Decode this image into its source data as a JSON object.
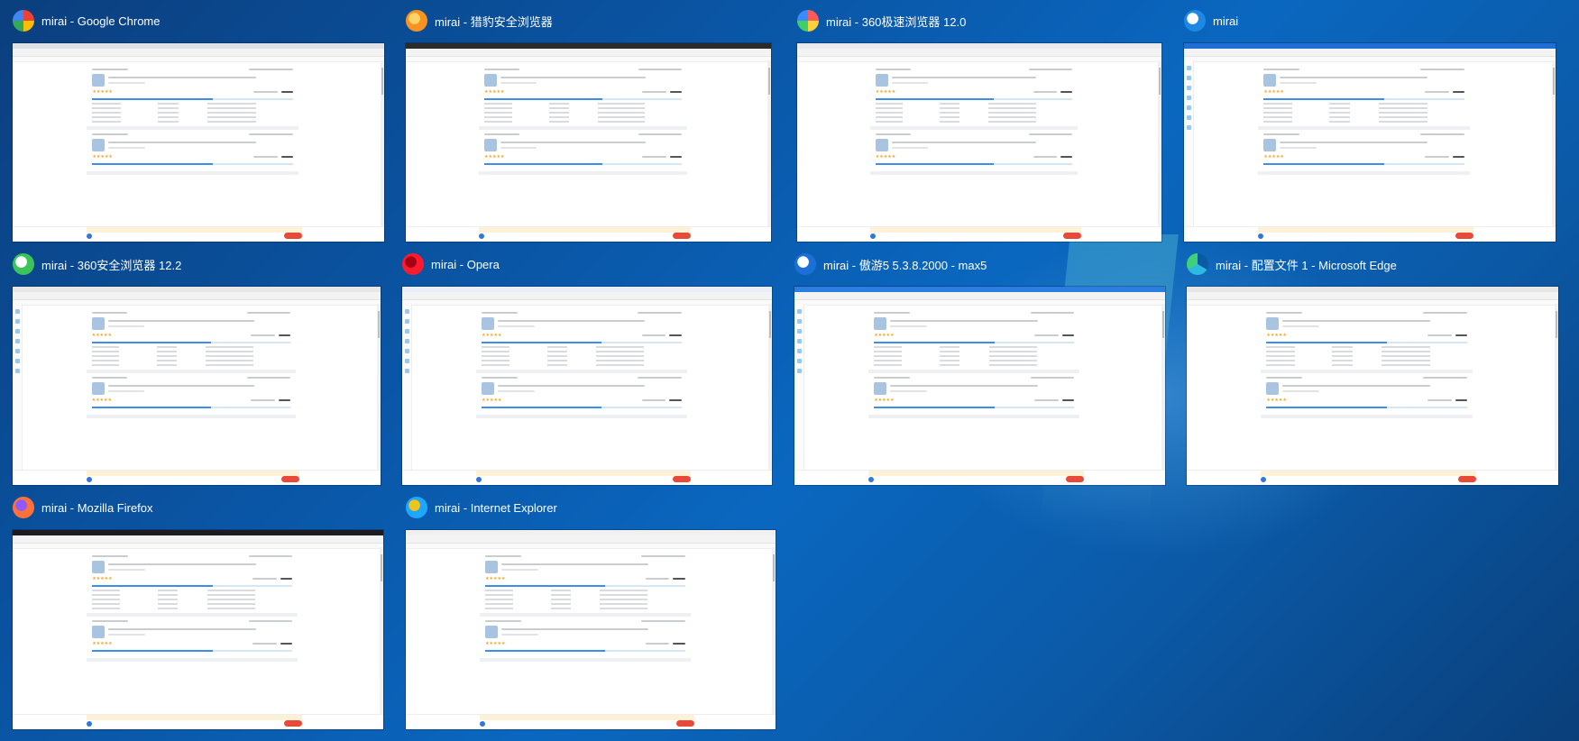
{
  "windows": [
    {
      "title": "mirai - Google Chrome",
      "icon": "chrome-icon",
      "icon_colors": [
        "#ea4335",
        "#fbbc05",
        "#34a853",
        "#4285f4"
      ],
      "tabbar_color": "#dee1e6"
    },
    {
      "title": "mirai - 猎豹安全浏览器",
      "icon": "liebao-browser-icon",
      "icon_colors": [
        "#f7931e",
        "#ffd36a"
      ],
      "tabbar_color": "#2b2b2b"
    },
    {
      "title": "mirai - 360极速浏览器 12.0",
      "icon": "360-speed-browser-icon",
      "icon_colors": [
        "#ff5a5a",
        "#ffd23a",
        "#3fcf6a",
        "#3a8bff"
      ],
      "tabbar_color": "#e8eaed"
    },
    {
      "title": "mirai",
      "icon": "mirai-icon",
      "icon_colors": [
        "#1e88e5",
        "#ffffff"
      ],
      "tabbar_color": "#1f6fd6"
    },
    {
      "title": "mirai - 360安全浏览器 12.2",
      "icon": "360-secure-browser-icon",
      "icon_colors": [
        "#3ac45a",
        "#ffffff"
      ],
      "tabbar_color": "#e7e7e7"
    },
    {
      "title": "mirai - Opera",
      "icon": "opera-icon",
      "icon_colors": [
        "#ff1b2d",
        "#a70014"
      ],
      "tabbar_color": "#e9eef6"
    },
    {
      "title": "mirai - 傲游5 5.3.8.2000 - max5",
      "icon": "maxthon-icon",
      "icon_colors": [
        "#1d6fd8",
        "#ffffff"
      ],
      "tabbar_color": "#2a7de1"
    },
    {
      "title": "mirai - 配置文件 1 - Microsoft Edge",
      "icon": "edge-icon",
      "icon_colors": [
        "#0c59a4",
        "#2cbbe0",
        "#3fd07a"
      ],
      "tabbar_color": "#e6e6e6"
    },
    {
      "title": "mirai - Mozilla Firefox",
      "icon": "firefox-icon",
      "icon_colors": [
        "#ff7139",
        "#9059ff"
      ],
      "tabbar_color": "#1c1b22"
    },
    {
      "title": "mirai - Internet Explorer",
      "icon": "internet-explorer-icon",
      "icon_colors": [
        "#1ea7ff",
        "#f0c419"
      ],
      "tabbar_color": "#f0f0f0"
    }
  ]
}
